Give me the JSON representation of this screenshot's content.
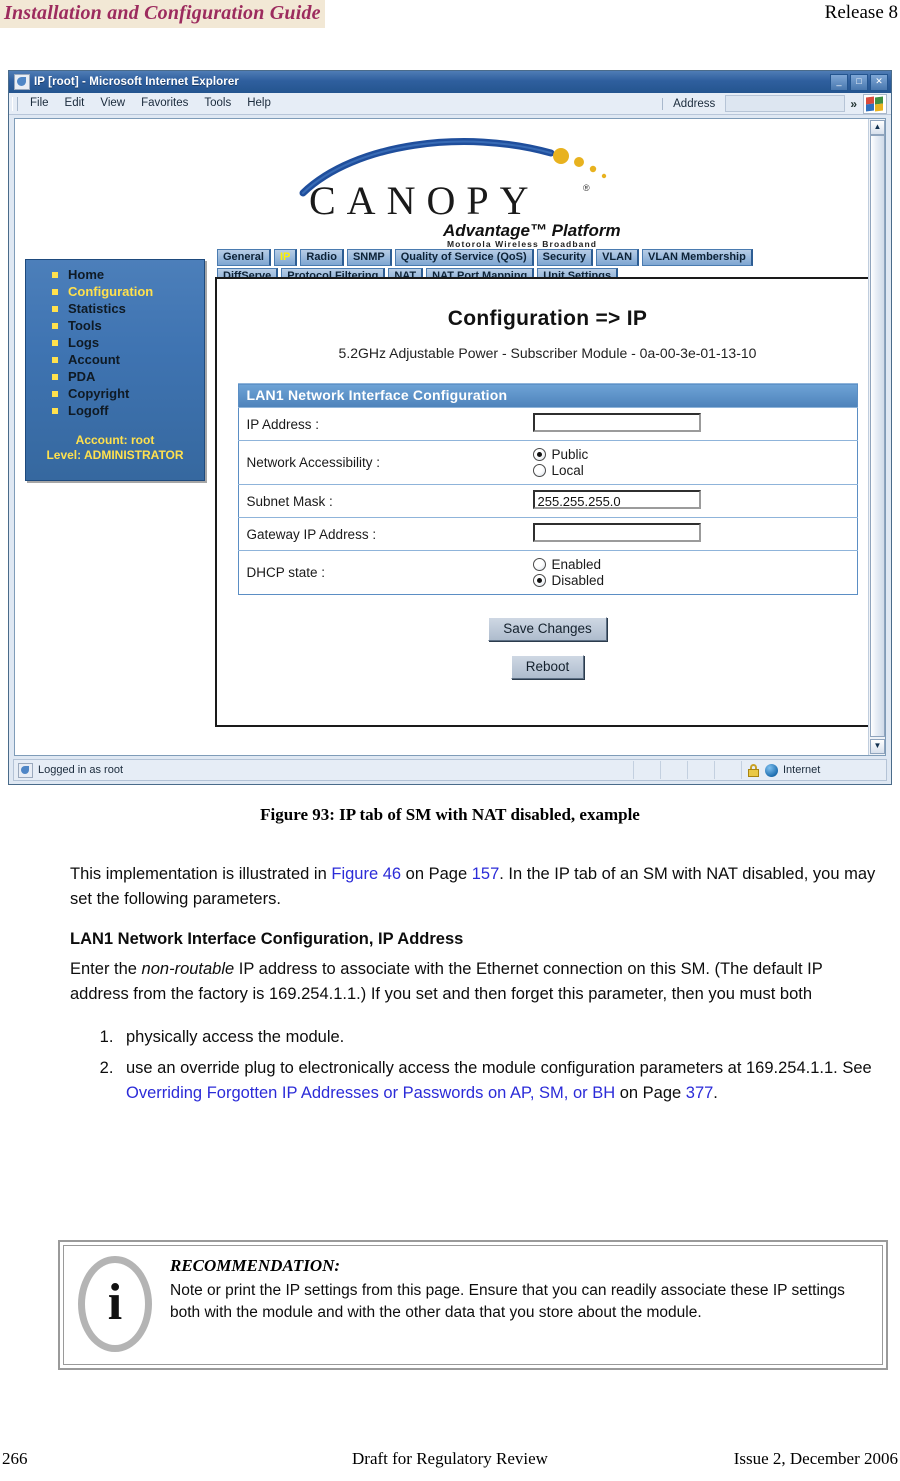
{
  "header": {
    "title": "Installation and Configuration Guide",
    "release": "Release 8",
    "title_bg": "#f2e8d5",
    "title_color": "#9c2b5e"
  },
  "browser": {
    "window_title": "IP [root] - Microsoft Internet Explorer",
    "minimize_label": "_",
    "maximize_label": "□",
    "close_label": "✕",
    "menu": [
      {
        "label": "File"
      },
      {
        "label": "Edit"
      },
      {
        "label": "View"
      },
      {
        "label": "Favorites"
      },
      {
        "label": "Tools"
      },
      {
        "label": "Help"
      }
    ],
    "address_label": "Address",
    "address_value": "",
    "toolbar_overflow": "»",
    "status_left": "Logged in as root",
    "status_zone": "Internet"
  },
  "logo": {
    "word": "CANOPY",
    "trademark": "®",
    "tagline": "Advantage™ Platform",
    "subtagline": "Motorola Wireless Broadband",
    "swoosh_color": "#1f4e9c",
    "dot_color": "#e8b21f"
  },
  "leftnav": {
    "items": [
      {
        "label": "Home",
        "active": false
      },
      {
        "label": "Configuration",
        "active": true
      },
      {
        "label": "Statistics",
        "active": false
      },
      {
        "label": "Tools",
        "active": false
      },
      {
        "label": "Logs",
        "active": false
      },
      {
        "label": "Account",
        "active": false
      },
      {
        "label": "PDA",
        "active": false
      },
      {
        "label": "Copyright",
        "active": false
      },
      {
        "label": "Logoff",
        "active": false
      }
    ],
    "account_line": "Account: root",
    "level_line": "Level: ADMINISTRATOR"
  },
  "tabs": {
    "row1": [
      {
        "label": "General",
        "active": false
      },
      {
        "label": "IP",
        "active": true
      },
      {
        "label": "Radio",
        "active": false
      },
      {
        "label": "SNMP",
        "active": false
      },
      {
        "label": "Quality of Service (QoS)",
        "active": false
      },
      {
        "label": "Security",
        "active": false
      },
      {
        "label": "VLAN",
        "active": false
      },
      {
        "label": "VLAN Membership",
        "active": false
      }
    ],
    "row2": [
      {
        "label": "DiffServe",
        "active": false
      },
      {
        "label": "Protocol Filtering",
        "active": false
      },
      {
        "label": "NAT",
        "active": false
      },
      {
        "label": "NAT Port Mapping",
        "active": false
      },
      {
        "label": "Unit Settings",
        "active": false
      }
    ]
  },
  "panel": {
    "title": "Configuration => IP",
    "subtitle": "5.2GHz Adjustable Power - Subscriber Module - 0a-00-3e-01-13-10",
    "section_header": "LAN1 Network Interface Configuration",
    "fields": {
      "ip_address_label": "IP Address :",
      "ip_address_value": "",
      "network_accessibility_label": "Network Accessibility :",
      "network_accessibility_public": "Public",
      "network_accessibility_local": "Local",
      "subnet_mask_label": "Subnet Mask :",
      "subnet_mask_value": "255.255.255.0",
      "gateway_label": "Gateway IP Address :",
      "gateway_value": "",
      "dhcp_label": "DHCP state :",
      "dhcp_enabled": "Enabled",
      "dhcp_disabled": "Disabled"
    },
    "save_button": "Save Changes",
    "reboot_button": "Reboot"
  },
  "figure": {
    "caption": "Figure 93: IP tab of SM with NAT disabled, example"
  },
  "body": {
    "intro_p1": "This implementation is illustrated in ",
    "intro_link1": "Figure 46",
    "intro_p2": " on Page ",
    "intro_link2": "157",
    "intro_p3": ". In the IP tab of an SM with NAT disabled, you may set the following parameters.",
    "heading": "LAN1 Network Interface Configuration, IP Address",
    "para_a": "Enter the ",
    "para_italic": "non-routable",
    "para_b": " IP address to associate with the Ethernet connection on this SM. (The default IP address from the factory is 169.254.1.1.) If you set and then forget this parameter, then you must both",
    "step1": "physically access the module.",
    "step2_a": "use an override plug to electronically access the module configuration parameters at 169.254.1.1. See ",
    "step2_link": "Overriding Forgotten IP Addresses or Passwords on AP, SM, or BH",
    "step2_b": " on Page ",
    "step2_link2": "377",
    "step2_c": ".",
    "link_color": "#2b2bd8"
  },
  "recommendation": {
    "icon_glyph": "i",
    "title": "RECOMMENDATION:",
    "text": "Note or print the IP settings from this page. Ensure that you can readily associate these IP settings both with the module and with the other data that you store about the module."
  },
  "footer": {
    "page_number": "266",
    "center": "Draft for Regulatory Review",
    "right": "Issue 2, December 2006"
  }
}
